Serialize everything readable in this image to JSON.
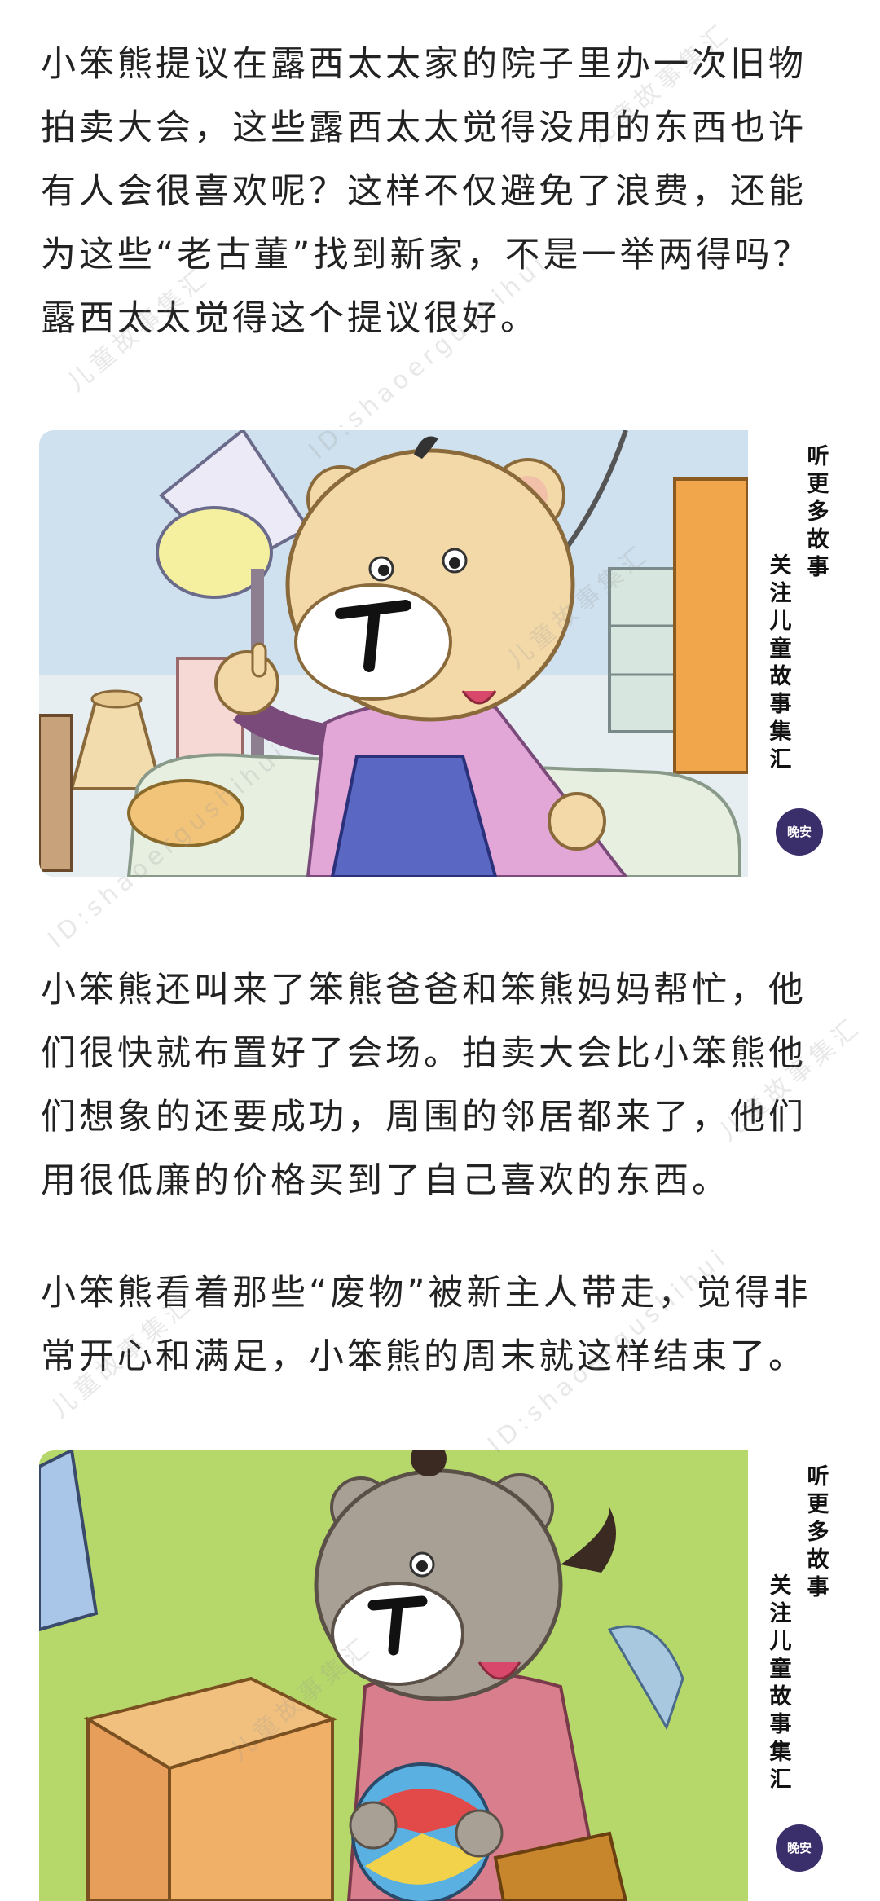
{
  "paragraphs": [
    "小笨熊提议在露西太太家的院子里办一次旧物拍卖大会，这些露西太太觉得没用的东西也许有人会很喜欢呢？这样不仅避免了浪费，还能为这些“老古董”找到新家，不是一举两得吗？露西太太觉得这个提议很好。",
    "小笨熊还叫来了笨熊爸爸和笨熊妈妈帮忙，他们很快就布置好了会场。拍卖大会比小笨熊他们想象的还要成功，周围的邻居都来了，他们用很低廉的价格买到了自己喜欢的东西。",
    "小笨熊看着那些“废物”被新主人带走，觉得非常开心和满足，小笨熊的周末就这样结束了。"
  ],
  "promo": {
    "line1": "听更多故事",
    "line2": "关注儿童故事集汇",
    "badge": "晚安"
  },
  "watermark": {
    "line1": "儿童故事集汇",
    "line2": "ID:shaoergushihui"
  },
  "colors": {
    "text": "#222222",
    "scene1_bg": "#cfe0ee",
    "scene2_bg": "#b6d86a",
    "bear_fur": "#f3d9a8",
    "bear2_fur": "#a9a095",
    "sweater_pink": "#e2a7d6",
    "sweater_red": "#d87e8c"
  }
}
